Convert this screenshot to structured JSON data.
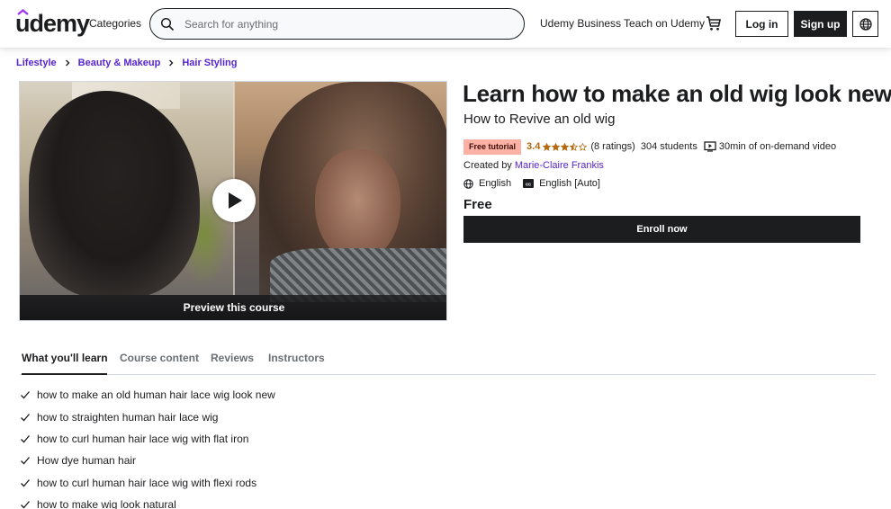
{
  "header": {
    "logo_text": "udemy",
    "categories_label": "Categories",
    "search": {
      "placeholder": "Search for anything",
      "value": ""
    },
    "udemy_business_label": "Udemy Business",
    "teach_label": "Teach on Udemy",
    "login_label": "Log in",
    "signup_label": "Sign up",
    "icons": {
      "search": "search-icon",
      "cart": "cart-icon",
      "language": "globe-icon"
    }
  },
  "breadcrumb": [
    {
      "label": "Lifestyle"
    },
    {
      "label": "Beauty & Makeup"
    },
    {
      "label": "Hair Styling"
    }
  ],
  "preview": {
    "label": "Preview this course",
    "icon": "play-icon"
  },
  "course": {
    "title": "Learn how to make an old wig look new",
    "subtitle": "How to Revive an old wig",
    "badge": "Free tutorial",
    "rating": "3.4",
    "rating_value": 3.4,
    "rating_max": 5,
    "ratings_count": "(8 ratings)",
    "students": "304 students",
    "video_length": "30min of on-demand video",
    "created_by_label": "Created by",
    "instructor": "Marie-Claire Frankis",
    "language": "English",
    "captions": "English [Auto]",
    "price": "Free",
    "enroll_label": "Enroll now"
  },
  "colors": {
    "brand_purple": "#5624d0",
    "rating_orange": "#b4690e",
    "badge_bg": "#fbb2a4",
    "dark": "#1c1d1f"
  },
  "tabs": [
    {
      "label": "What you'll learn",
      "active": true
    },
    {
      "label": "Course content",
      "active": false
    },
    {
      "label": "Reviews",
      "active": false
    },
    {
      "label": "Instructors",
      "active": false
    }
  ],
  "learn_items": [
    "how to make an old human hair lace wig look new",
    "how to straighten human hair lace wig",
    "how to curl human hair lace wig with flat iron",
    "How dye human hair",
    "how to curl human hair lace wig with flexi rods",
    "how to make wig look natural"
  ]
}
